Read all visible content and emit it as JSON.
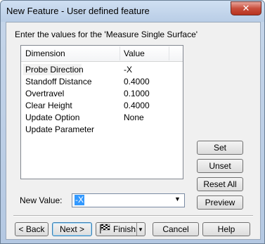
{
  "window": {
    "title": "New Feature - User defined feature",
    "close_glyph": "✕"
  },
  "prompt": "Enter the values for the 'Measure Single Surface'",
  "table": {
    "columns": [
      "Dimension",
      "Value"
    ],
    "rows": [
      {
        "dimension": "Probe Direction",
        "value": "-X"
      },
      {
        "dimension": "Standoff Distance",
        "value": "0.4000"
      },
      {
        "dimension": "Overtravel",
        "value": "0.1000"
      },
      {
        "dimension": "Clear Height",
        "value": "0.4000"
      },
      {
        "dimension": "Update Option",
        "value": "None"
      },
      {
        "dimension": "Update Parameter",
        "value": ""
      }
    ]
  },
  "side_buttons": {
    "set": "Set",
    "unset": "Unset",
    "reset_all": "Reset All",
    "preview": "Preview"
  },
  "new_value": {
    "label": "New Value:",
    "value": "-X"
  },
  "footer": {
    "back": "< Back",
    "next": "Next >",
    "finish": "Finish",
    "cancel": "Cancel",
    "help": "Help"
  },
  "colors": {
    "selection": "#3399ff",
    "close": "#c94e3c"
  }
}
